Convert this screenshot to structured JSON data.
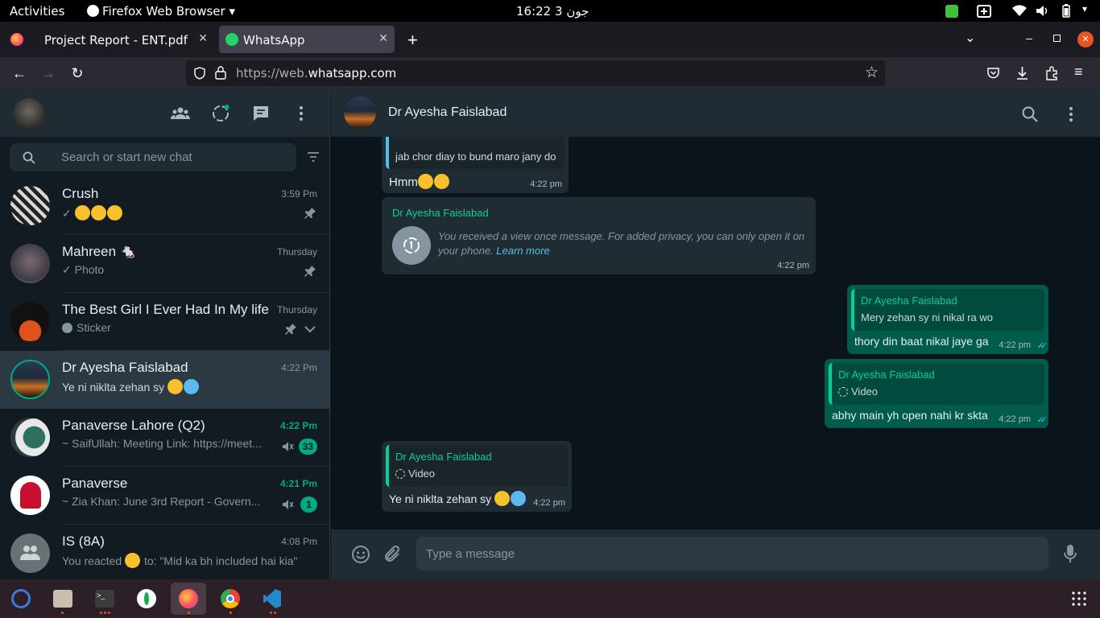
{
  "topbar": {
    "activities": "Activities",
    "app_menu": "Firefox Web Browser",
    "clock": "جون 3  16:22"
  },
  "browser": {
    "tabs": [
      {
        "label": "Project Report - ENT.pdf",
        "active": false
      },
      {
        "label": "WhatsApp",
        "active": true
      }
    ],
    "url_prefix": "https://web.",
    "url_domain": "whatsapp.com"
  },
  "sidebar": {
    "search_placeholder": "Search or start new chat",
    "chats": [
      {
        "name": "Crush",
        "time": "3:59 Pm",
        "preview": "✓",
        "pinned": true
      },
      {
        "name": "Mahreen 🐁",
        "time": "Thursday",
        "preview": "✓ Photo",
        "pinned": true
      },
      {
        "name": "The Best Girl I Ever Had In My life",
        "time": "Thursday",
        "preview": "Sticker",
        "pinned": true
      },
      {
        "name": "Dr Ayesha Faislabad",
        "time": "4:22 Pm",
        "preview": "Ye ni niklta zehan sy",
        "selected": true
      },
      {
        "name": "Panaverse Lahore (Q2)",
        "time": "4:22 Pm",
        "preview": "~ SaifUllah: Meeting Link: https://meet...",
        "unread": "33",
        "muted": true
      },
      {
        "name": "Panaverse",
        "time": "4:21 Pm",
        "preview": "~ Zia Khan: June 3rd Report - Govern...",
        "unread": "1",
        "muted": true
      },
      {
        "name": "IS (8A)",
        "time": "4:08 Pm",
        "preview_a": "You reacted",
        "preview_b": "to: \"Mid ka bh included hai kia\""
      }
    ]
  },
  "chat": {
    "contact_name": "Dr Ayesha Faislabad",
    "messages": [
      {
        "dir": "in",
        "quote_text": "jab chor diay to bund maro jany do",
        "text": "Hmm",
        "time": "4:22 pm"
      },
      {
        "dir": "in",
        "sender": "Dr Ayesha Faislabad",
        "text": "You received a view once message. For added privacy, you can only open it on",
        "text2": "your phone.",
        "link": "Learn more",
        "time": "4:22 pm"
      },
      {
        "dir": "out",
        "quote_name": "Dr Ayesha Faislabad",
        "quote_text": "Mery zehan sy ni nikal ra wo",
        "text": "thory din baat nikal jaye ga",
        "time": "4:22 pm"
      },
      {
        "dir": "out",
        "quote_name": "Dr Ayesha Faislabad",
        "quote_text": "Video",
        "text": "abhy main yh open nahi kr skta",
        "time": "4:22 pm"
      },
      {
        "dir": "in",
        "quote_name": "Dr Ayesha Faislabad",
        "quote_text": "Video",
        "text": "Ye ni niklta zehan sy",
        "time": "4:22 pm"
      }
    ],
    "composer_placeholder": "Type a message"
  },
  "colors": {
    "accent": "#00a884",
    "outgoing_bubble": "#005c4b",
    "incoming_bubble": "#202c33"
  }
}
